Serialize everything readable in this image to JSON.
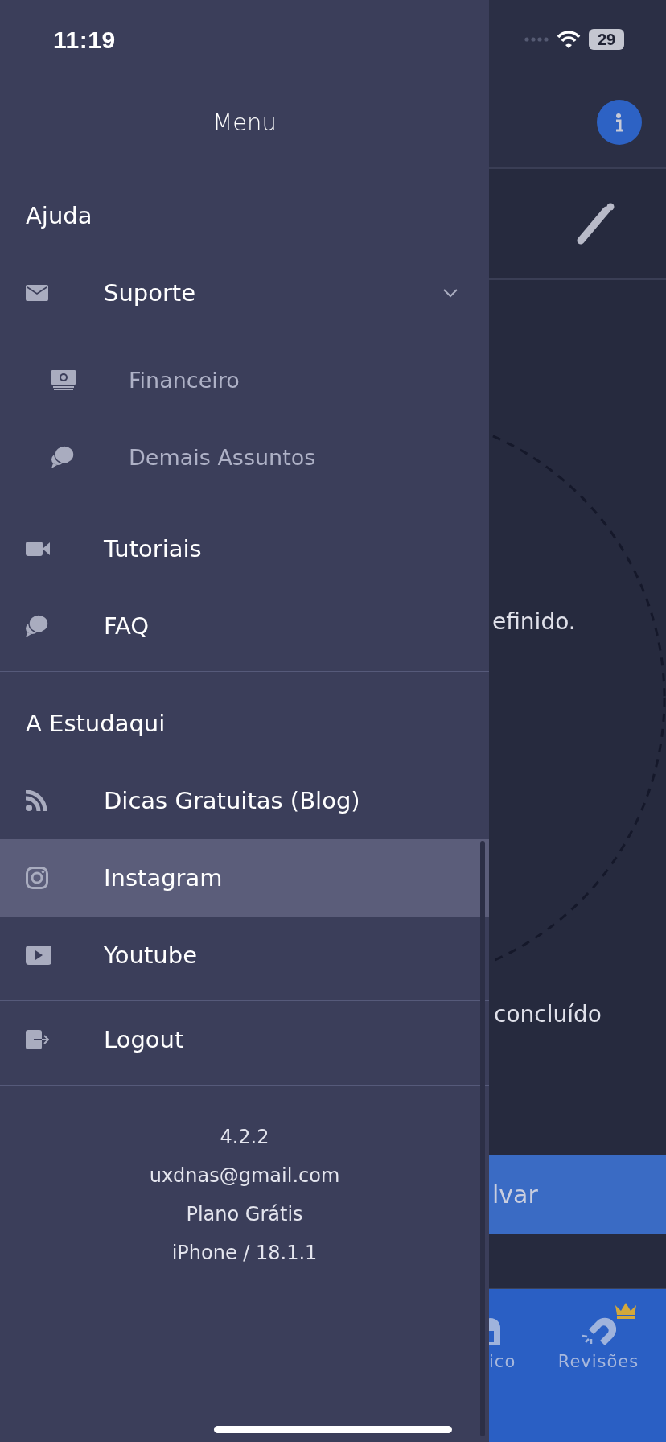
{
  "status_bar": {
    "time": "11:19",
    "battery": "29"
  },
  "drawer": {
    "title": "Menu",
    "sections": [
      {
        "title": "Ajuda",
        "items": [
          {
            "label": "Suporte",
            "kind": "mail",
            "selected": false,
            "expanded": true,
            "children": [
              {
                "label": "Financeiro",
                "kind": "money",
                "selected": false
              },
              {
                "label": "Demais Assuntos",
                "kind": "chat",
                "selected": false
              }
            ]
          },
          {
            "label": "Tutoriais",
            "kind": "video",
            "selected": false
          },
          {
            "label": "FAQ",
            "kind": "chat",
            "selected": false
          }
        ]
      },
      {
        "title": "A Estudaqui",
        "items": [
          {
            "label": "Dicas Gratuitas (Blog)",
            "kind": "rss",
            "selected": false
          },
          {
            "label": "Instagram",
            "kind": "instagram",
            "selected": true
          },
          {
            "label": "Youtube",
            "kind": "youtube",
            "selected": false
          }
        ]
      },
      {
        "items": [
          {
            "label": "Logout",
            "kind": "logout",
            "selected": false
          }
        ]
      }
    ],
    "footer": [
      "4.2.2",
      "uxdnas@gmail.com",
      "Plano Grátis",
      "iPhone / 18.1.1"
    ]
  },
  "background": {
    "texts": [
      "efinido.",
      "concluído"
    ],
    "button": "lvar",
    "tabs": [
      {
        "label": "ico",
        "kind": "lock",
        "premium": false
      },
      {
        "label": "Revisões",
        "kind": "magnet",
        "premium": true
      }
    ]
  }
}
